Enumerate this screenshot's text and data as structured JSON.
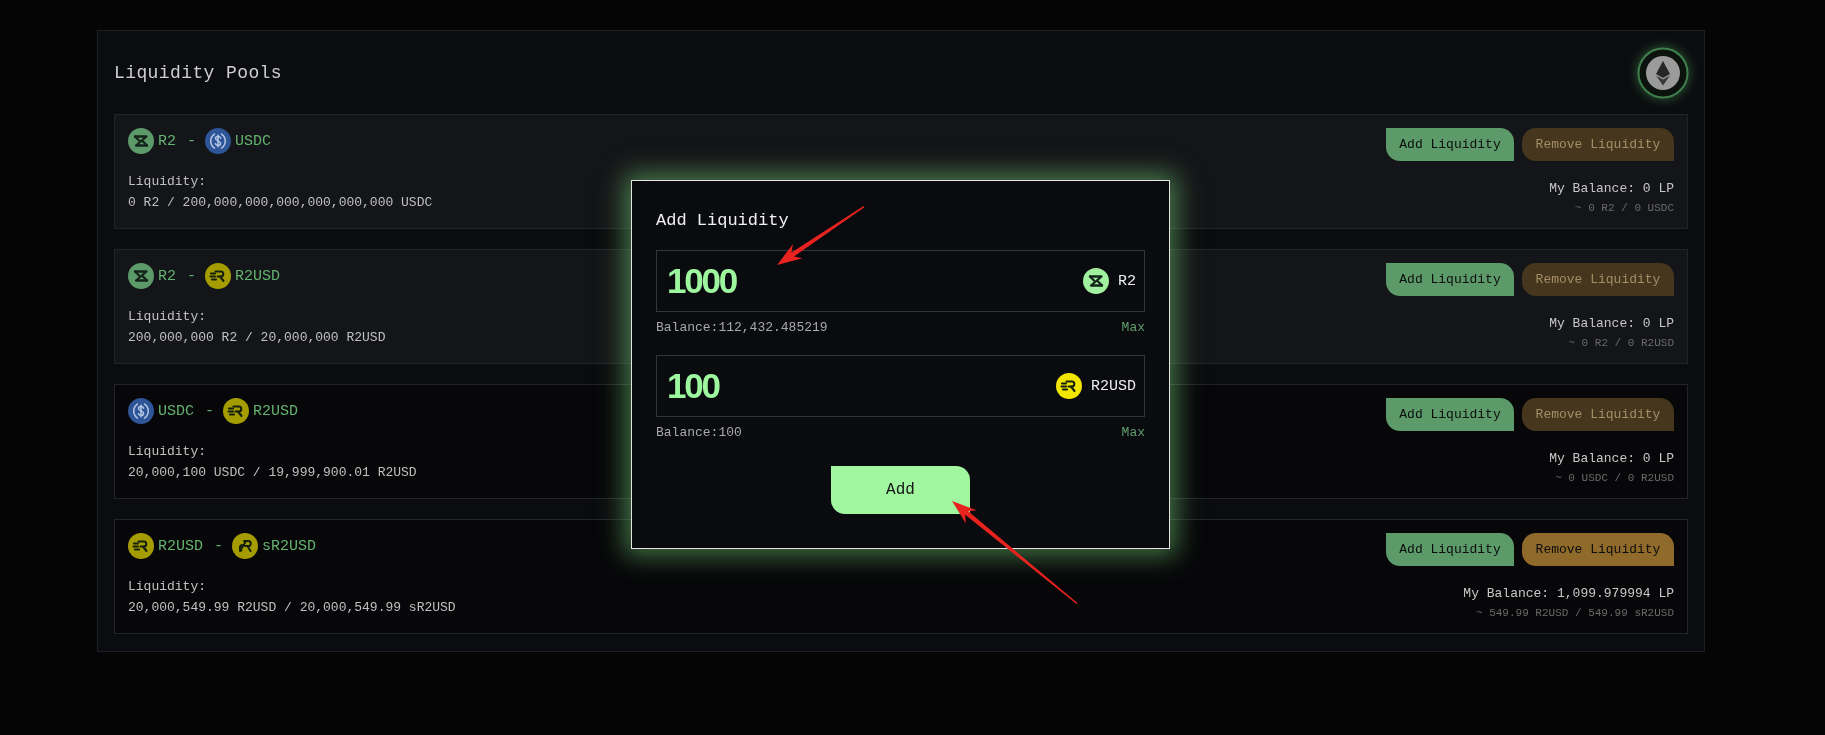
{
  "page": {
    "title": "Liquidity Pools"
  },
  "pools": [
    {
      "highlighted": true,
      "tokens": [
        {
          "kind": "r2",
          "symbol": "R2"
        },
        {
          "kind": "usdc",
          "symbol": "USDC"
        }
      ],
      "separator": "-",
      "liquidity_label": "Liquidity:",
      "liquidity": "0 R2 / 200,000,000,000,000,000,000 USDC",
      "add_button": {
        "label": "Add Liquidity"
      },
      "remove_button": {
        "label": "Remove Liquidity",
        "disabled": true
      },
      "balance": "My Balance: 0 LP",
      "balance_detail": "~ 0 R2 / 0 USDC"
    },
    {
      "highlighted": true,
      "tokens": [
        {
          "kind": "r2",
          "symbol": "R2"
        },
        {
          "kind": "r2usd",
          "symbol": "R2USD"
        }
      ],
      "separator": "-",
      "liquidity_label": "Liquidity:",
      "liquidity": "200,000,000 R2 / 20,000,000 R2USD",
      "add_button": {
        "label": "Add Liquidity"
      },
      "remove_button": {
        "label": "Remove Liquidity",
        "disabled": true
      },
      "balance": "My Balance: 0 LP",
      "balance_detail": "~ 0 R2 / 0 R2USD"
    },
    {
      "highlighted": false,
      "tokens": [
        {
          "kind": "usdc",
          "symbol": "USDC"
        },
        {
          "kind": "r2usd",
          "symbol": "R2USD"
        }
      ],
      "separator": "-",
      "liquidity_label": "Liquidity:",
      "liquidity": "20,000,100 USDC / 19,999,900.01 R2USD",
      "add_button": {
        "label": "Add Liquidity"
      },
      "remove_button": {
        "label": "Remove Liquidity",
        "disabled": true
      },
      "balance": "My Balance: 0 LP",
      "balance_detail": "~ 0 USDC / 0 R2USD"
    },
    {
      "highlighted": false,
      "tokens": [
        {
          "kind": "r2usd",
          "symbol": "R2USD"
        },
        {
          "kind": "sr2usd",
          "symbol": "sR2USD"
        }
      ],
      "separator": "-",
      "liquidity_label": "Liquidity:",
      "liquidity": "20,000,549.99 R2USD / 20,000,549.99 sR2USD",
      "add_button": {
        "label": "Add Liquidity"
      },
      "remove_button": {
        "label": "Remove Liquidity",
        "disabled": false
      },
      "balance": "My Balance: 1,099.979994 LP",
      "balance_detail": "~ 549.99 R2USD / 549.99 sR2USD"
    }
  ],
  "modal": {
    "title": "Add Liquidity",
    "fields": [
      {
        "value": "1000",
        "token": {
          "kind": "r2",
          "symbol": "R2"
        },
        "balance": "Balance:112,432.485219",
        "max": "Max"
      },
      {
        "value": "100",
        "token": {
          "kind": "r2usd",
          "symbol": "R2USD"
        },
        "balance": "Balance:100",
        "max": "Max"
      }
    ],
    "submit": "Add"
  }
}
